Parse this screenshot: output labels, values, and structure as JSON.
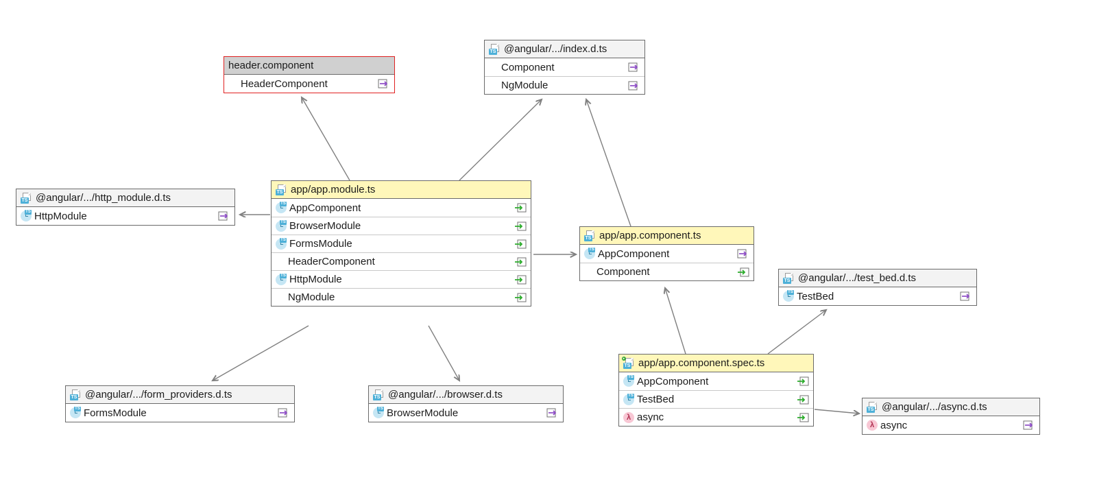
{
  "nodes": {
    "header_component": {
      "title": "header.component",
      "members": [
        {
          "label": "HeaderComponent",
          "icon": "none",
          "dir": "export-purple"
        }
      ]
    },
    "angular_index": {
      "title": "@angular/.../index.d.ts",
      "members": [
        {
          "label": "Component",
          "icon": "none",
          "dir": "export-purple"
        },
        {
          "label": "NgModule",
          "icon": "none",
          "dir": "export-purple"
        }
      ]
    },
    "angular_http_module": {
      "title": "@angular/.../http_module.d.ts",
      "members": [
        {
          "label": "HttpModule",
          "icon": "clock",
          "dir": "export-purple"
        }
      ]
    },
    "app_module": {
      "title": "app/app.module.ts",
      "members": [
        {
          "label": "AppComponent",
          "icon": "clock",
          "dir": "import-green"
        },
        {
          "label": "BrowserModule",
          "icon": "clock",
          "dir": "import-green"
        },
        {
          "label": "FormsModule",
          "icon": "clock",
          "dir": "import-green"
        },
        {
          "label": "HeaderComponent",
          "icon": "none",
          "dir": "import-green"
        },
        {
          "label": "HttpModule",
          "icon": "clock",
          "dir": "import-green"
        },
        {
          "label": "NgModule",
          "icon": "none",
          "dir": "import-green"
        }
      ]
    },
    "app_component": {
      "title": "app/app.component.ts",
      "members": [
        {
          "label": "AppComponent",
          "icon": "clock",
          "dir": "export-purple"
        },
        {
          "label": "Component",
          "icon": "none",
          "dir": "import-green"
        }
      ]
    },
    "angular_test_bed": {
      "title": "@angular/.../test_bed.d.ts",
      "members": [
        {
          "label": "TestBed",
          "icon": "clock",
          "dir": "export-purple"
        }
      ]
    },
    "angular_form_providers": {
      "title": "@angular/.../form_providers.d.ts",
      "members": [
        {
          "label": "FormsModule",
          "icon": "clock",
          "dir": "export-purple"
        }
      ]
    },
    "angular_browser": {
      "title": "@angular/.../browser.d.ts",
      "members": [
        {
          "label": "BrowserModule",
          "icon": "clock",
          "dir": "export-purple"
        }
      ]
    },
    "app_component_spec": {
      "title": "app/app.component.spec.ts",
      "members": [
        {
          "label": "AppComponent",
          "icon": "clock",
          "dir": "import-green"
        },
        {
          "label": "TestBed",
          "icon": "clock",
          "dir": "import-green"
        },
        {
          "label": "async",
          "icon": "lambda",
          "dir": "import-green"
        }
      ]
    },
    "angular_async": {
      "title": "@angular/.../async.d.ts",
      "members": [
        {
          "label": "async",
          "icon": "lambda",
          "dir": "export-purple"
        }
      ]
    }
  },
  "arrows": [
    {
      "from": "app_module",
      "to": "header_component"
    },
    {
      "from": "app_module",
      "to": "angular_index"
    },
    {
      "from": "app_module",
      "to": "angular_http_module"
    },
    {
      "from": "app_module",
      "to": "app_component"
    },
    {
      "from": "app_module",
      "to": "angular_form_providers"
    },
    {
      "from": "app_module",
      "to": "angular_browser"
    },
    {
      "from": "app_component",
      "to": "angular_index"
    },
    {
      "from": "app_component_spec",
      "to": "app_component"
    },
    {
      "from": "app_component_spec",
      "to": "angular_test_bed"
    },
    {
      "from": "app_component_spec",
      "to": "angular_async"
    }
  ],
  "colors": {
    "arrow": "#808080",
    "import_arrow": "#2cac2c",
    "export_arrow": "#9050c8",
    "yellow_bg": "#fff7ba",
    "gray_bg": "#d0d0d0",
    "node_border": "#6a6a6a",
    "red_border": "#e02020"
  }
}
